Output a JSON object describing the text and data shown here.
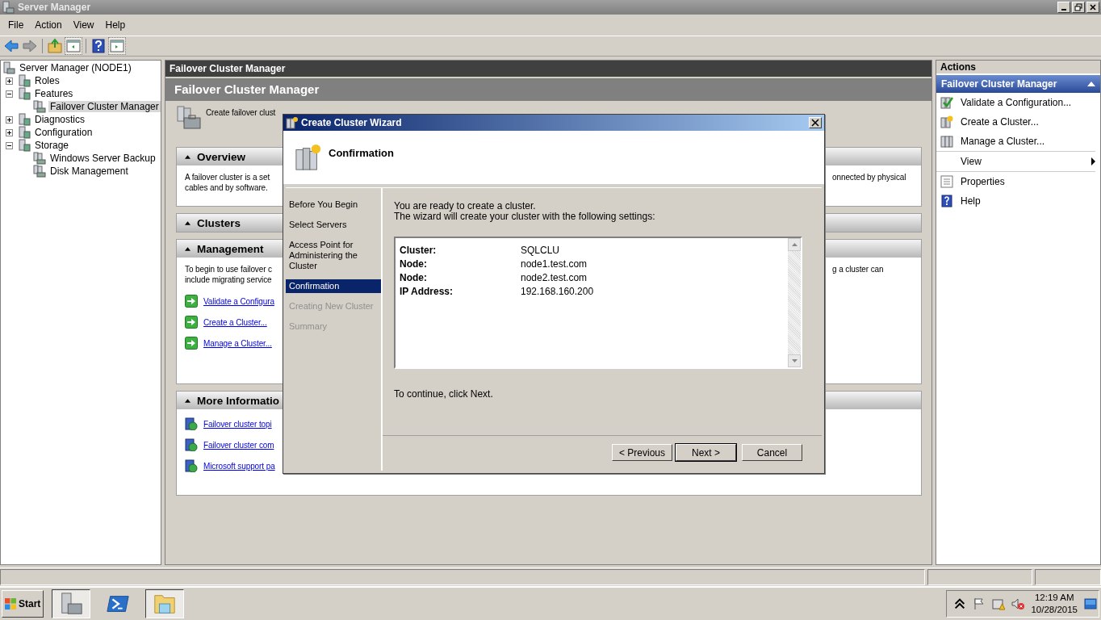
{
  "window": {
    "title": "Server Manager"
  },
  "menu": [
    "File",
    "Action",
    "View",
    "Help"
  ],
  "tree": [
    {
      "label": "Server Manager (NODE1)",
      "selected": false,
      "children": [
        {
          "label": "Roles",
          "expanded": false,
          "selected": false
        },
        {
          "label": "Features",
          "expanded": true,
          "selected": false,
          "children": [
            {
              "label": "Failover Cluster Manager",
              "selected": true
            }
          ]
        },
        {
          "label": "Diagnostics",
          "expanded": false,
          "selected": false
        },
        {
          "label": "Configuration",
          "expanded": false,
          "selected": false
        },
        {
          "label": "Storage",
          "expanded": true,
          "selected": false,
          "children": [
            {
              "label": "Windows Server Backup",
              "selected": false
            },
            {
              "label": "Disk Management",
              "selected": false
            }
          ]
        }
      ]
    }
  ],
  "center": {
    "breadcrumb": "Failover Cluster Manager",
    "title": "Failover Cluster Manager",
    "description": "Create failover clust",
    "panels": [
      {
        "title": "Overview",
        "left": [
          "A failover cluster is a set",
          "cables and by software."
        ],
        "right": [
          "onnected by physical"
        ]
      },
      {
        "title": "Clusters"
      },
      {
        "title": "Management",
        "left": [
          "To begin to use failover c",
          "include migrating service"
        ],
        "right": [
          "g a cluster can"
        ],
        "links": [
          {
            "kind": "action",
            "label": "Validate a Configura"
          },
          {
            "kind": "action",
            "label": "Create a Cluster..."
          },
          {
            "kind": "action",
            "label": "Manage a Cluster..."
          }
        ]
      },
      {
        "title": "More Informatio",
        "links": [
          {
            "kind": "help",
            "label": "Failover cluster topi"
          },
          {
            "kind": "help",
            "label": "Failover cluster com"
          },
          {
            "kind": "help",
            "label": "Microsoft support pa"
          }
        ]
      }
    ]
  },
  "wizard": {
    "title": "Create Cluster Wizard",
    "heading": "Confirmation",
    "steps": [
      {
        "label": "Before You Begin",
        "selected": false,
        "disabled": false
      },
      {
        "label": "Select Servers",
        "selected": false,
        "disabled": false
      },
      {
        "label": "Access Point for Administering the Cluster",
        "selected": false,
        "disabled": false
      },
      {
        "label": "Confirmation",
        "selected": true,
        "disabled": false
      },
      {
        "label": "Creating New Cluster",
        "selected": false,
        "disabled": true
      },
      {
        "label": "Summary",
        "selected": false,
        "disabled": true
      }
    ],
    "intro": [
      "You are ready to create a cluster.",
      "The wizard will create your cluster with the following settings:"
    ],
    "settings": [
      {
        "label": "Cluster:",
        "value": "SQLCLU"
      },
      {
        "label": "Node:",
        "value": "node1.test.com"
      },
      {
        "label": "Node:",
        "value": "node2.test.com"
      },
      {
        "label": "IP Address:",
        "value": "192.168.160.200"
      }
    ],
    "footer": "To continue, click Next.",
    "buttons": [
      {
        "label": "< Previous",
        "default": false
      },
      {
        "label": "Next >",
        "default": true
      },
      {
        "label": "Cancel",
        "default": false
      }
    ]
  },
  "actions": {
    "title": "Actions",
    "section": "Failover Cluster Manager",
    "items": [
      {
        "kind": "validate",
        "label": "Validate a Configuration..."
      },
      {
        "kind": "create",
        "label": "Create a Cluster..."
      },
      {
        "kind": "manage",
        "label": "Manage a Cluster..."
      },
      {
        "kind": "submenu",
        "label": "View"
      },
      {
        "kind": "properties",
        "label": "Properties"
      },
      {
        "kind": "help",
        "label": "Help"
      }
    ]
  },
  "taskbar": {
    "start": "Start",
    "tasks": [
      {
        "kind": "server",
        "selected": true
      },
      {
        "kind": "shell",
        "selected": false
      },
      {
        "kind": "folder",
        "selected": true
      }
    ],
    "time": "12:19 AM",
    "date": "10/28/2015"
  }
}
